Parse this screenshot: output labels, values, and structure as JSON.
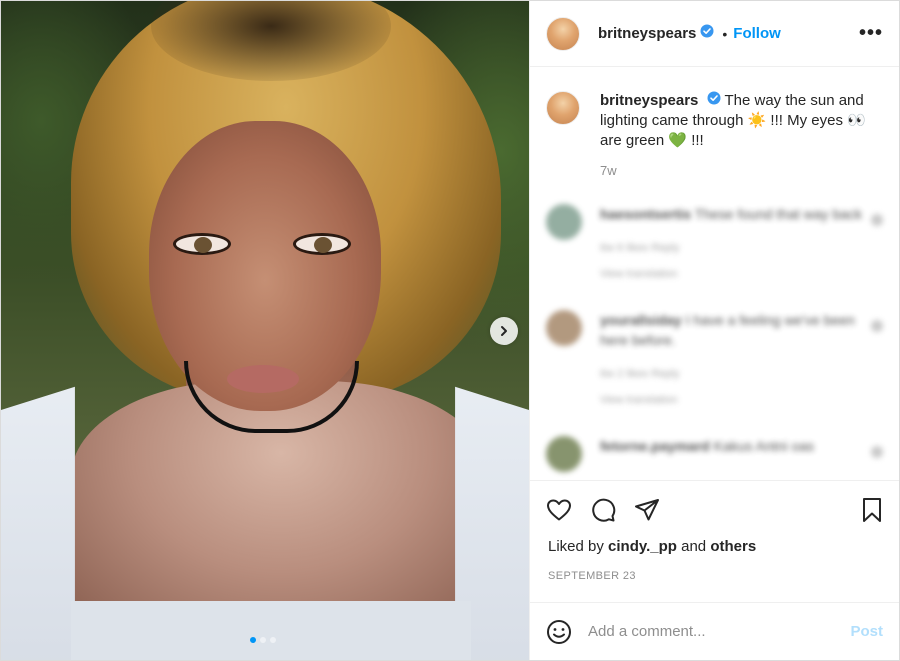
{
  "header": {
    "username": "britneyspears",
    "separator": "•",
    "follow_label": "Follow",
    "more_label": "•••"
  },
  "caption": {
    "username": "britneyspears",
    "text": "The way the sun and lighting came through ☀️ !!! My eyes 👀 are green 💚 !!!",
    "age": "7w"
  },
  "blurred_comments": [
    {
      "user": "haesontsertis",
      "text": "These found that way back",
      "meta": "6w   6 likes   Reply",
      "sub": "View translation"
    },
    {
      "user": "yourallsiday",
      "text": "I have a feeling we've been here before.",
      "meta": "6w   2 likes   Reply",
      "sub": "View translation"
    },
    {
      "user": "fetorne.paymard",
      "text": "Kakus Antni oas",
      "meta": "",
      "sub": ""
    }
  ],
  "likes": {
    "prefix": "Liked by",
    "user": "cindy._pp",
    "and": "and",
    "others": "others"
  },
  "date": "SEPTEMBER 23",
  "add_comment": {
    "placeholder": "Add a comment...",
    "post_label": "Post"
  },
  "carousel": {
    "count": 3,
    "active_index": 0
  },
  "colors": {
    "accent": "#0095f6",
    "post_disabled": "#b2dffc",
    "muted": "#8e8e8e",
    "text": "#262626"
  },
  "icons": [
    "verified-badge-icon",
    "heart-icon",
    "comment-icon",
    "share-icon",
    "bookmark-icon",
    "emoji-icon",
    "chevron-right-icon",
    "more-icon"
  ]
}
